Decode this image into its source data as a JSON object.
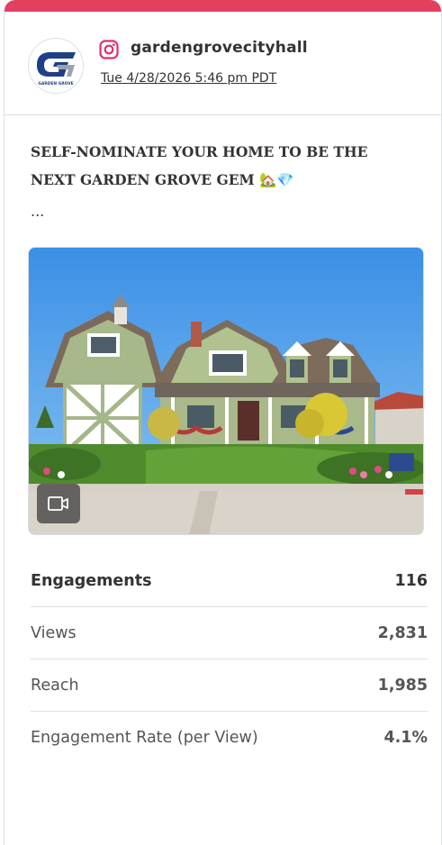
{
  "post": {
    "account": "gardengrovecityhall",
    "timestamp": "Tue 4/28/2026 5:46 pm PDT",
    "text": "SELF-NOMINATE YOUR HOME TO BE THE NEXT GARDEN GROVE GEM 🏡💎",
    "more": "...",
    "platform_icon": "instagram-icon",
    "media_type_icon": "video-icon",
    "avatar_text": "GARDEN GROVE"
  },
  "colors": {
    "accent_bar": "#e3405f",
    "instagram": "#e1306c"
  },
  "metrics": [
    {
      "label": "Engagements",
      "value": "116",
      "primary": true
    },
    {
      "label": "Views",
      "value": "2,831",
      "primary": false
    },
    {
      "label": "Reach",
      "value": "1,985",
      "primary": false
    },
    {
      "label": "Engagement Rate (per View)",
      "value": "4.1%",
      "primary": false
    }
  ]
}
